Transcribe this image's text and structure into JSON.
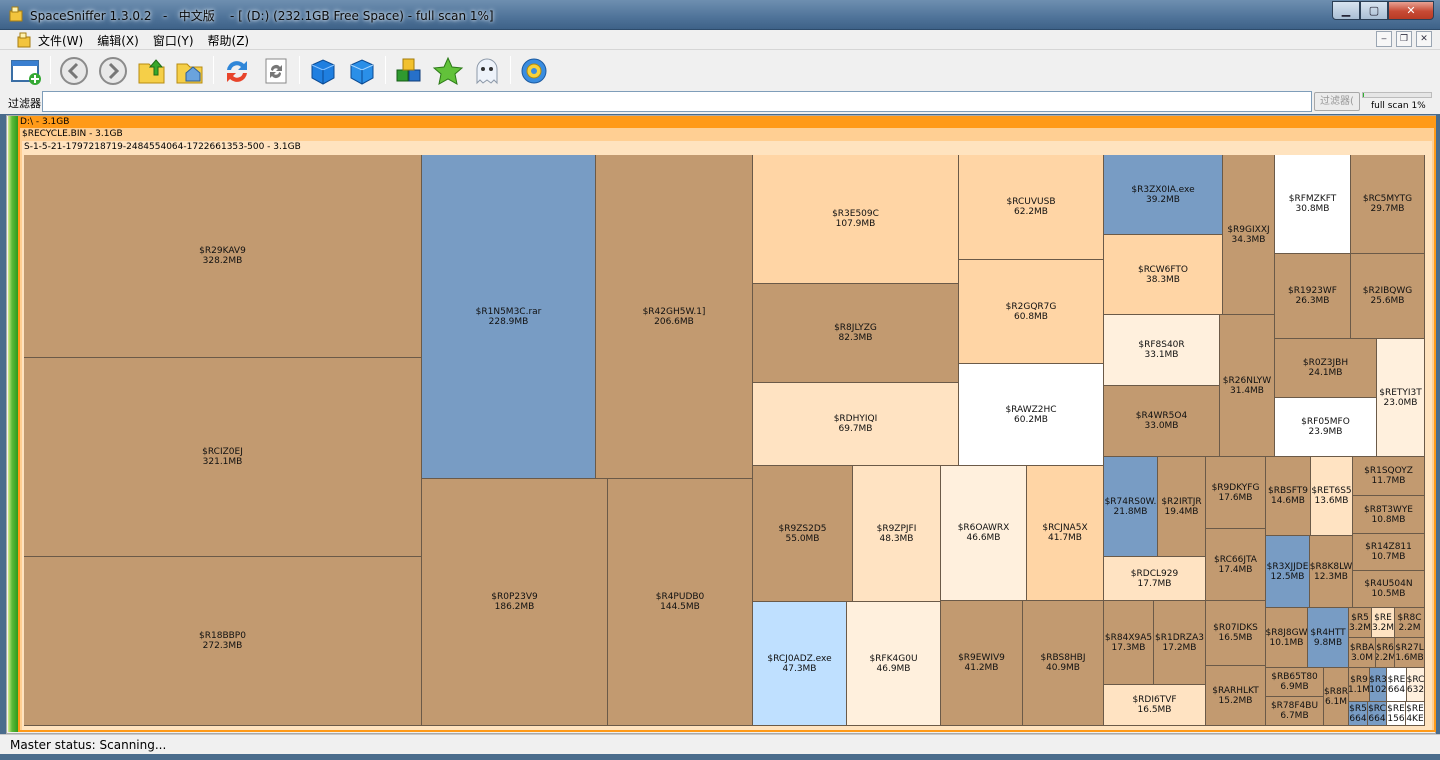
{
  "window": {
    "title": "SpaceSniffer 1.3.0.2   -   中文版    - [ (D:) (232.1GB Free Space) - full scan 1%]",
    "btn_min": "▁",
    "btn_max": "▢",
    "btn_close": "✕"
  },
  "menu": {
    "items": [
      "文件(W)",
      "编辑(X)",
      "窗口(Y)",
      "帮助(Z)"
    ],
    "mdi": [
      "‒",
      "❐",
      "✕"
    ]
  },
  "toolbar": {
    "icons": [
      "new-window-icon",
      "back-icon",
      "forward-icon",
      "up-folder-icon",
      "home-icon",
      "refresh-icon",
      "rescan-icon",
      "zoom-in-cube-icon",
      "zoom-out-cube-icon",
      "blocks-icon",
      "star-icon",
      "ghost-icon",
      "settings-icon"
    ]
  },
  "filter": {
    "label": "过滤器",
    "value": "",
    "button": "过滤器(",
    "scan_progress": 0.01,
    "scan_text": "full scan 1%"
  },
  "treemap": {
    "root": "D:\\ - 3.1GB",
    "recycle": "$RECYCLE.BIN - 3.1GB",
    "sid": "S-1-5-21-1797218719-2484554064-1722661353-500 - 3.1GB",
    "cells": [
      {
        "name": "$R29KAV9",
        "size": "328.2MB"
      },
      {
        "name": "$RCIZ0EJ",
        "size": "321.1MB"
      },
      {
        "name": "$R18BBP0",
        "size": "272.3MB"
      },
      {
        "name": "$R1N5M3C.rar",
        "size": "228.9MB"
      },
      {
        "name": "$R42GH5W.1]",
        "size": "206.6MB"
      },
      {
        "name": "$R0P23V9",
        "size": "186.2MB"
      },
      {
        "name": "$R4PUDB0",
        "size": "144.5MB"
      },
      {
        "name": "$R3E509C",
        "size": "107.9MB"
      },
      {
        "name": "$R8JLYZG",
        "size": "82.3MB"
      },
      {
        "name": "$RDHYIQI",
        "size": "69.7MB"
      },
      {
        "name": "$RCUVUSB",
        "size": "62.2MB"
      },
      {
        "name": "$R2GQR7G",
        "size": "60.8MB"
      },
      {
        "name": "$RAWZ2HC",
        "size": "60.2MB"
      },
      {
        "name": "$R9ZS2D5",
        "size": "55.0MB"
      },
      {
        "name": "$R9ZPJFI",
        "size": "48.3MB"
      },
      {
        "name": "$R6OAWRX",
        "size": "46.6MB"
      },
      {
        "name": "$RCJNA5X",
        "size": "41.7MB"
      },
      {
        "name": "$RCJ0ADZ.exe",
        "size": "47.3MB"
      },
      {
        "name": "$RFK4G0U",
        "size": "46.9MB"
      },
      {
        "name": "$R9EWIV9",
        "size": "41.2MB"
      },
      {
        "name": "$RBS8HBJ",
        "size": "40.9MB"
      },
      {
        "name": "$R3ZX0IA.exe",
        "size": "39.2MB"
      },
      {
        "name": "$RCW6FTO",
        "size": "38.3MB"
      },
      {
        "name": "$RF8S40R",
        "size": "33.1MB"
      },
      {
        "name": "$R4WR5O4",
        "size": "33.0MB"
      },
      {
        "name": "$R9GIXXJ",
        "size": "34.3MB"
      },
      {
        "name": "$R26NLYW",
        "size": "31.4MB"
      },
      {
        "name": "$RFMZKFT",
        "size": "30.8MB"
      },
      {
        "name": "$RC5MYTG",
        "size": "29.7MB"
      },
      {
        "name": "$R1923WF",
        "size": "26.3MB"
      },
      {
        "name": "$R2IBQWG",
        "size": "25.6MB"
      },
      {
        "name": "$R0Z3JBH",
        "size": "24.1MB"
      },
      {
        "name": "$RETYI3T",
        "size": "23.0MB"
      },
      {
        "name": "$RF05MFO",
        "size": "23.9MB"
      },
      {
        "name": "$R74RS0W.",
        "size": "21.8MB"
      },
      {
        "name": "$R2IRTJR",
        "size": "19.4MB"
      },
      {
        "name": "$R9DKYFG",
        "size": "17.6MB"
      },
      {
        "name": "$RBSFT9",
        "size": "14.6MB"
      },
      {
        "name": "$RET6S5",
        "size": "13.6MB"
      },
      {
        "name": "$R1SQOYZ",
        "size": "11.7MB"
      },
      {
        "name": "$R8T3WYE",
        "size": "10.8MB"
      },
      {
        "name": "$RC66JTA",
        "size": "17.4MB"
      },
      {
        "name": "$RDCL929",
        "size": "17.7MB"
      },
      {
        "name": "$R3XJJDE",
        "size": "12.5MB"
      },
      {
        "name": "$R8K8LW",
        "size": "12.3MB"
      },
      {
        "name": "$R14Z811",
        "size": "10.7MB"
      },
      {
        "name": "$R4U504N",
        "size": "10.5MB"
      },
      {
        "name": "$R84X9A5",
        "size": "17.3MB"
      },
      {
        "name": "$R1DRZA3",
        "size": "17.2MB"
      },
      {
        "name": "$R07IDKS",
        "size": "16.5MB"
      },
      {
        "name": "$R8J8GW",
        "size": "10.1MB"
      },
      {
        "name": "$R4HTT",
        "size": "9.8MB"
      },
      {
        "name": "$R5",
        "size": "3.2M"
      },
      {
        "name": "$RE",
        "size": "3.2M"
      },
      {
        "name": "$R8C",
        "size": "2.2M"
      },
      {
        "name": "$RBA",
        "size": "3.0M"
      },
      {
        "name": "$R6",
        "size": "2.2M"
      },
      {
        "name": "$R27L",
        "size": "1.6MB"
      },
      {
        "name": "$RDI6TVF",
        "size": "16.5MB"
      },
      {
        "name": "$RARHLKT",
        "size": "15.2MB"
      },
      {
        "name": "$RB65T80",
        "size": "6.9MB"
      },
      {
        "name": "$R78F4BU",
        "size": "6.7MB"
      },
      {
        "name": "$R8R",
        "size": "6.1M"
      },
      {
        "name": "$R9",
        "size": "1.1M"
      },
      {
        "name": "$R3",
        "size": "102"
      },
      {
        "name": "$RE",
        "size": "664"
      },
      {
        "name": "$RC",
        "size": "632"
      },
      {
        "name": "$R5",
        "size": "664"
      },
      {
        "name": "$RC",
        "size": "664"
      },
      {
        "name": "$RE",
        "size": "156"
      },
      {
        "name": "$RE",
        "size": "4KE"
      }
    ]
  },
  "status": {
    "text": "Master status: Scanning..."
  }
}
